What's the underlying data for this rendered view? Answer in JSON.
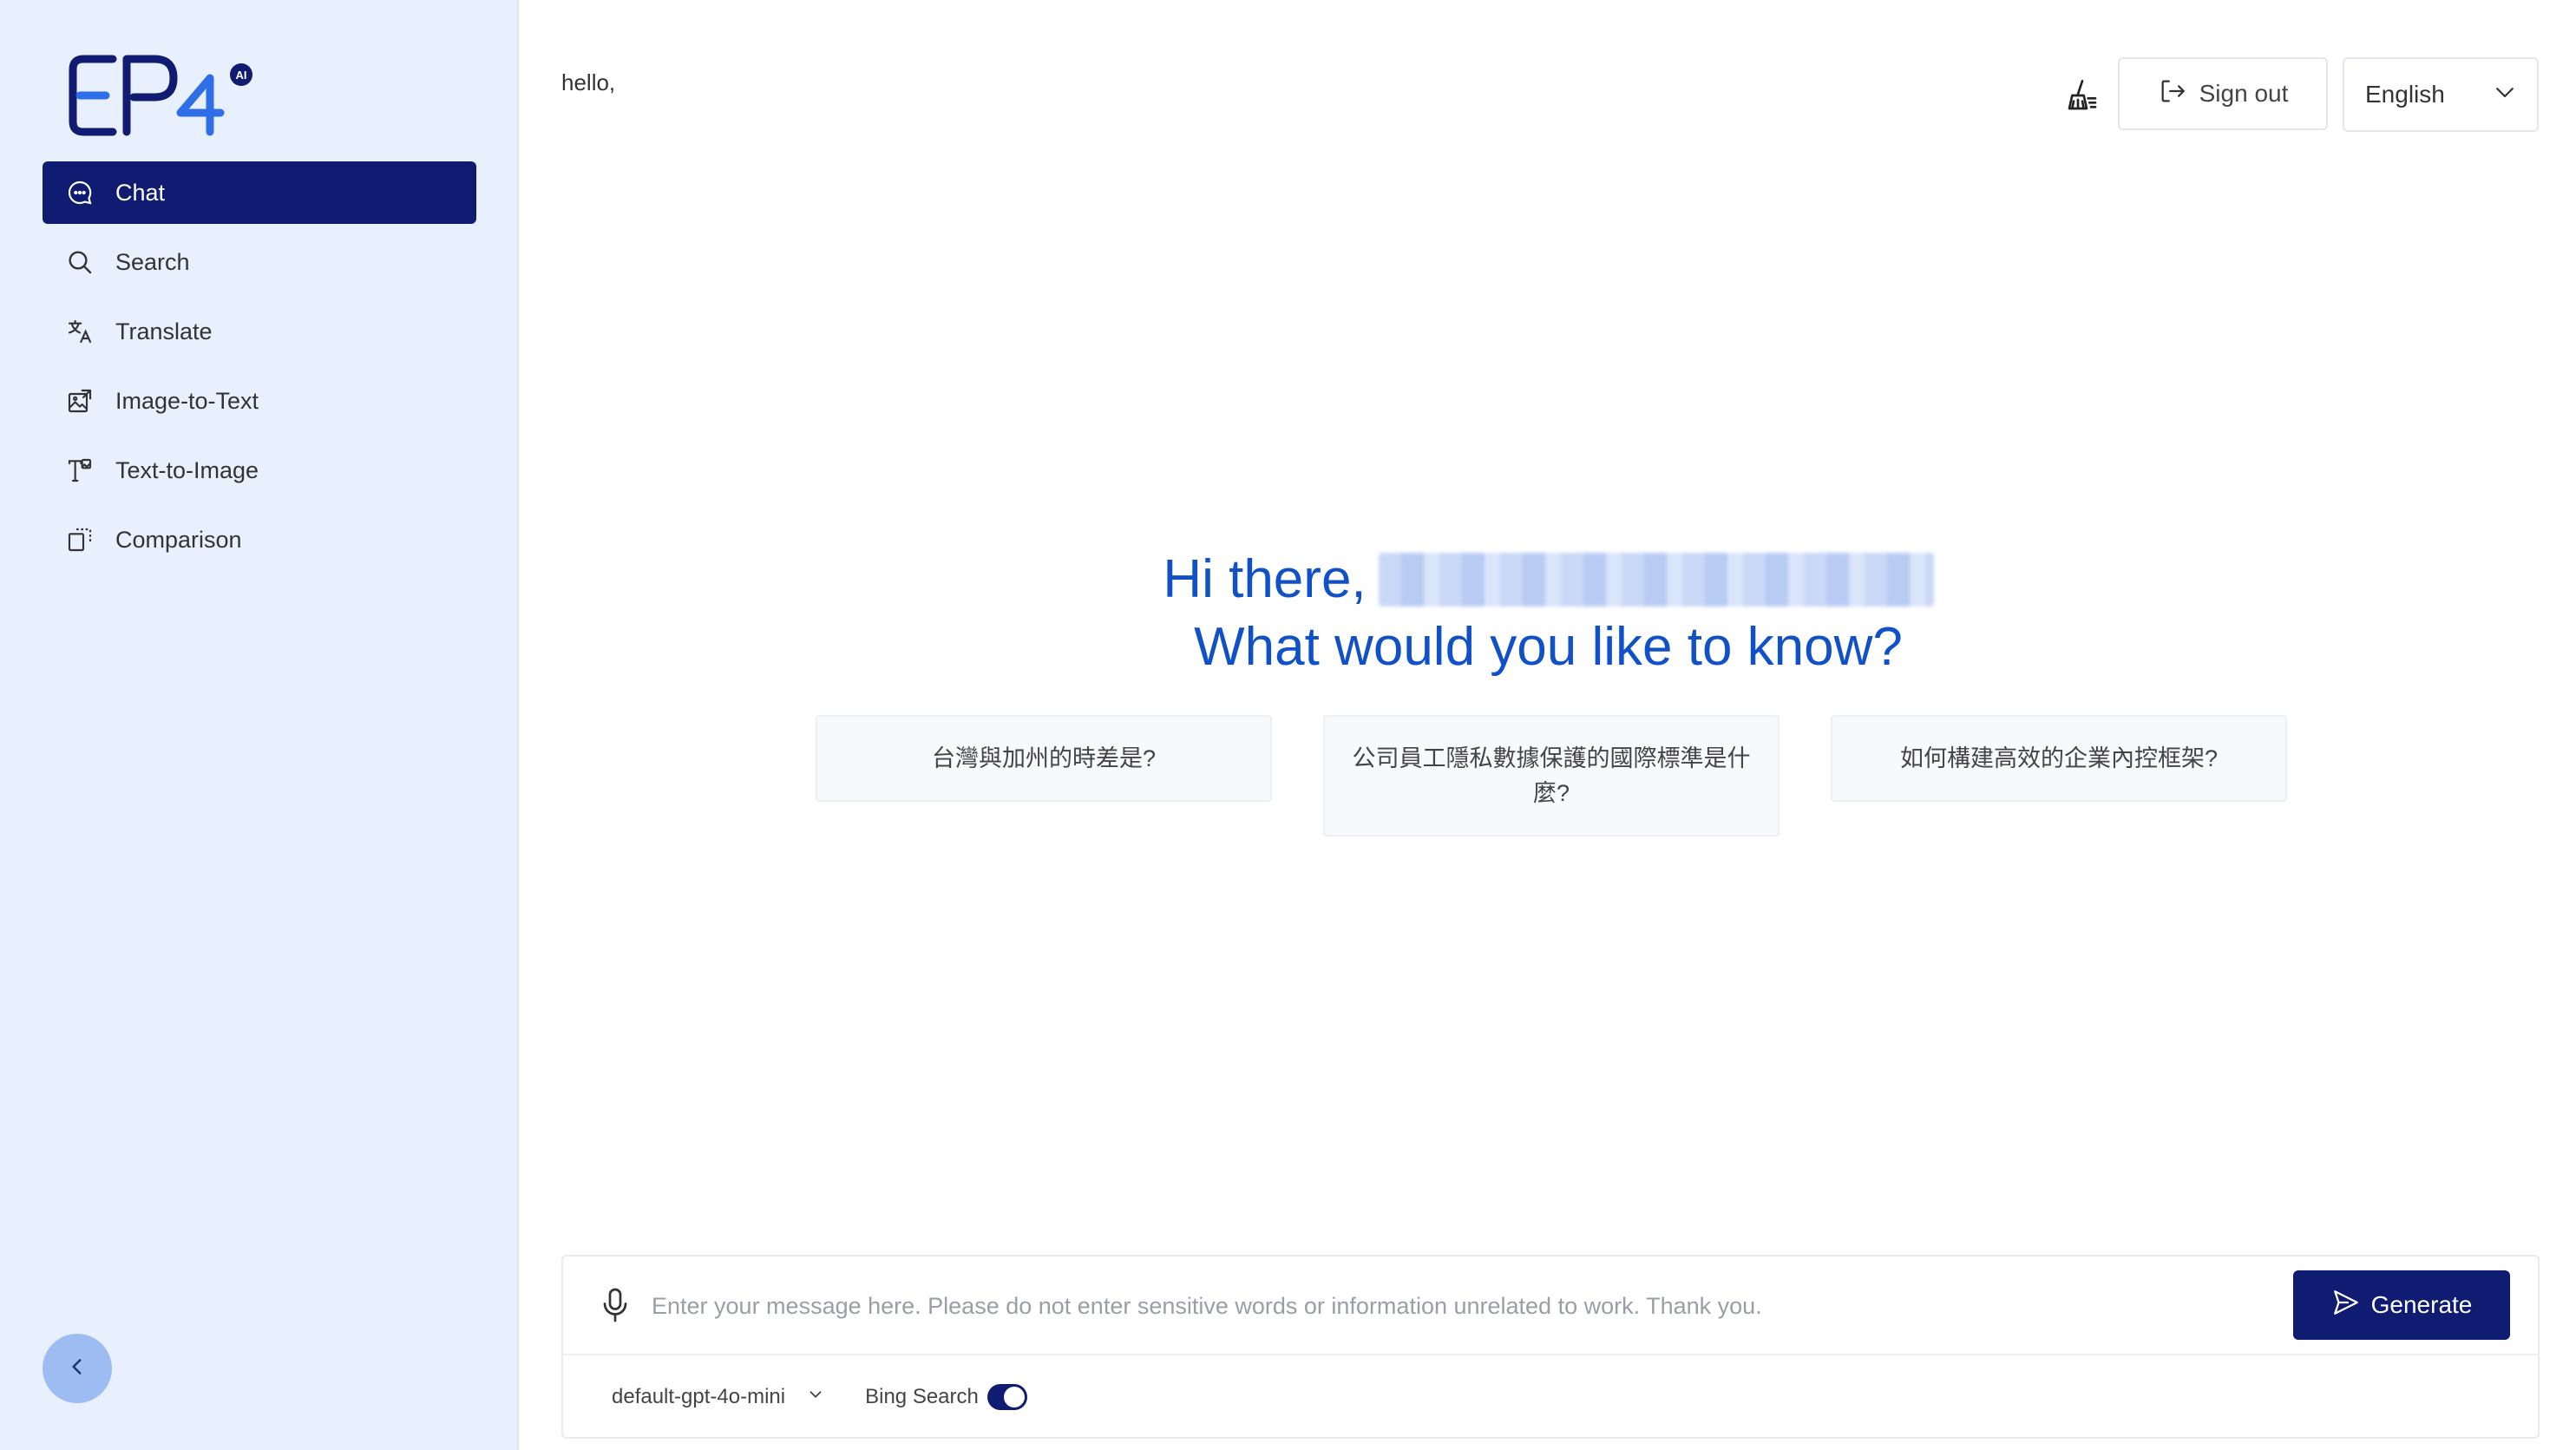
{
  "brand": {
    "logo_text": "EP4",
    "logo_badge": "AI"
  },
  "sidebar": {
    "items": [
      {
        "label": "Chat",
        "icon": "chat-icon",
        "active": true
      },
      {
        "label": "Search",
        "icon": "search-icon",
        "active": false
      },
      {
        "label": "Translate",
        "icon": "translate-icon",
        "active": false
      },
      {
        "label": "Image-to-Text",
        "icon": "image-to-text-icon",
        "active": false
      },
      {
        "label": "Text-to-Image",
        "icon": "text-to-image-icon",
        "active": false
      },
      {
        "label": "Comparison",
        "icon": "comparison-icon",
        "active": false
      }
    ],
    "collapse_icon": "chevron-left-icon"
  },
  "header": {
    "greeting": "hello,",
    "clear_icon": "broom-icon",
    "signout_label": "Sign out",
    "language": "English"
  },
  "hero": {
    "line1_prefix": "Hi there,",
    "line2": "What would you like to know?"
  },
  "suggestions": [
    "台灣與加州的時差是?",
    "公司員工隱私數據保護的國際標準是什麼?",
    "如何構建高效的企業內控框架?"
  ],
  "composer": {
    "placeholder": "Enter your message here. Please do not enter sensitive words or information unrelated to work. Thank you.",
    "generate_label": "Generate",
    "model": "default-gpt-4o-mini",
    "bing_label": "Bing Search",
    "bing_enabled": true
  },
  "colors": {
    "sidebar_bg": "#e8effd",
    "accent": "#101b72",
    "hero_text": "#1151c7",
    "collapse_btn": "#9dbcf2"
  }
}
